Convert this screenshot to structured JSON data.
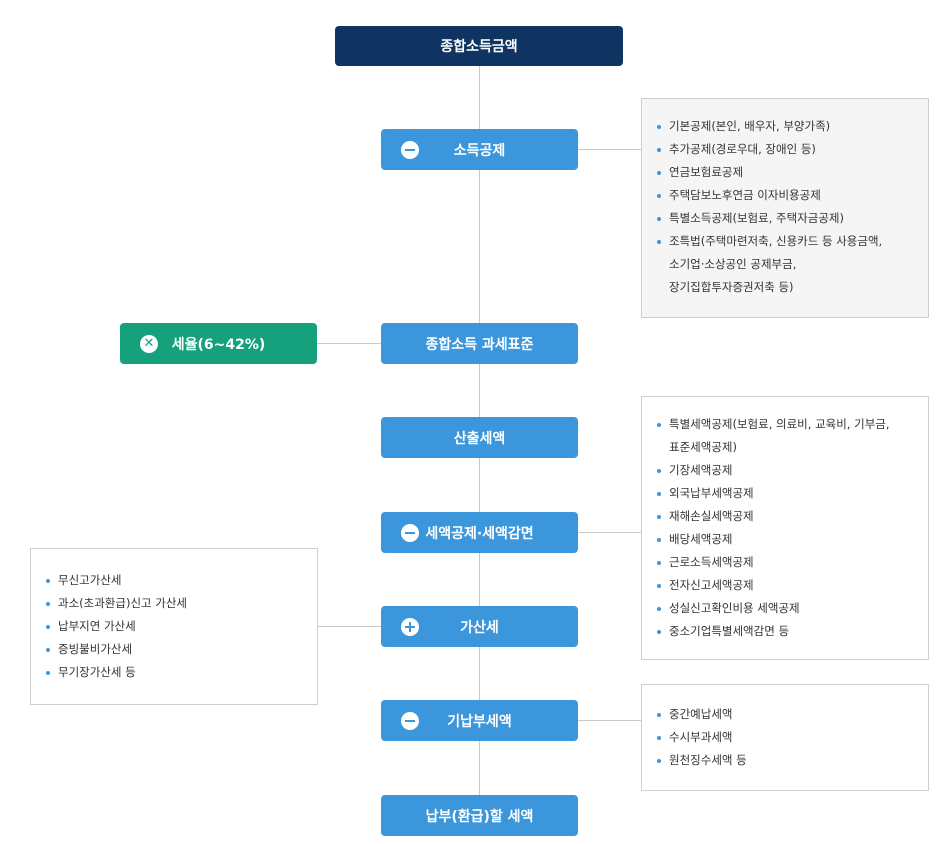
{
  "top": {
    "label": "종합소득금액"
  },
  "steps": {
    "deduction": "소득공제",
    "tax_base": "종합소득 과세표준",
    "computed_tax": "산출세액",
    "credit": "세액공제·세액감면",
    "penalty": "가산세",
    "prepaid": "기납부세액",
    "final": "납부(환급)할 세액"
  },
  "rate": {
    "label": "세율(6~42%)"
  },
  "panels": {
    "deduction_items": [
      "기본공제(본인, 배우자, 부양가족)",
      "추가공제(경로우대, 장애인 등)",
      "연금보험료공제",
      "주택담보노후연금 이자비용공제",
      "특별소득공제(보험료, 주택자금공제)",
      "조특법(주택마련저축, 신용카드 등 사용금액,",
      "소기업·소상공인 공제부금,",
      "장기집합투자증권저축 등)"
    ],
    "credit_items": [
      "특별세액공제(보험료, 의료비, 교육비, 기부금,",
      "표준세액공제)",
      "기장세액공제",
      "외국납부세액공제",
      "재해손실세액공제",
      "배당세액공제",
      "근로소득세액공제",
      "전자신고세액공제",
      "성실신고확인비용 세액공제",
      "중소기업특별세액감면 등"
    ],
    "penalty_items": [
      "무신고가산세",
      "과소(초과환급)신고 가산세",
      "납부지연 가산세",
      "증빙불비가산세",
      "무기장가산세 등"
    ],
    "prepaid_items": [
      "중간예납세액",
      "수시부과세액",
      "원천징수세액 등"
    ]
  },
  "icons": {
    "minus": "minus-circle-icon",
    "plus": "plus-circle-icon",
    "times": "times-circle-icon"
  },
  "colors": {
    "top_box": "#0f3461",
    "step_box": "#3b96dc",
    "rate_box": "#14a17c"
  }
}
